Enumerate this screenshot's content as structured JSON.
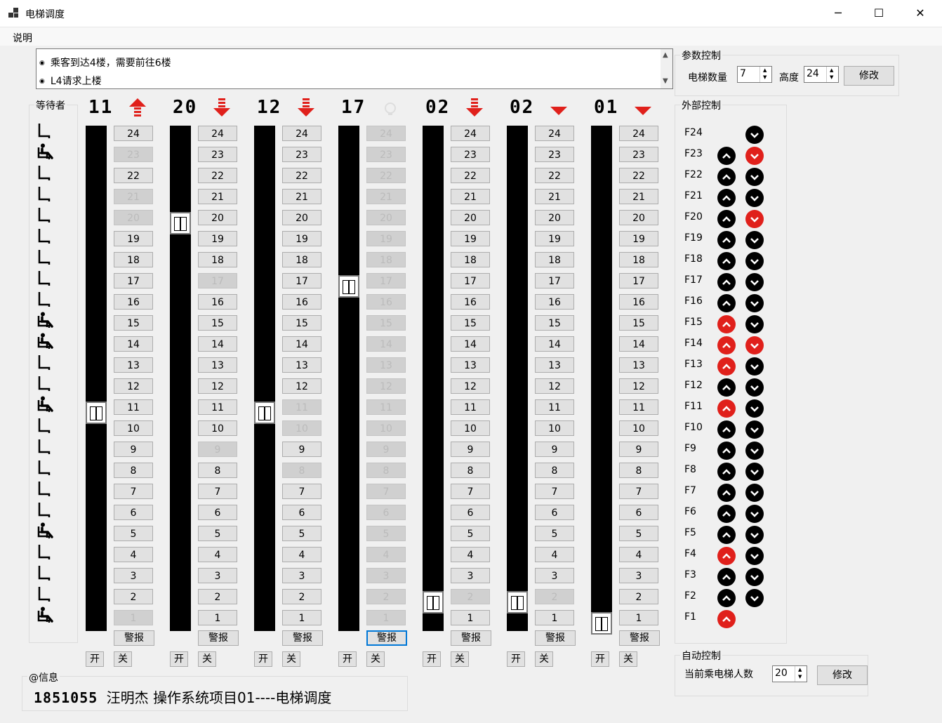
{
  "window": {
    "title": "电梯调度",
    "minimize": "─",
    "maximize": "☐",
    "close": "✕"
  },
  "menu": {
    "help": "说明"
  },
  "messages": [
    "乘客到达4楼，需要前往6楼",
    "L4请求上楼"
  ],
  "waiting": {
    "label": "等待者",
    "seated_floors": [
      23,
      15,
      14,
      11,
      5,
      1
    ]
  },
  "elevators": [
    {
      "floor_display": "11",
      "current_floor": 11,
      "direction": "up",
      "pressed": [
        23,
        21,
        20,
        1
      ],
      "alarm": "警报",
      "open": "开",
      "close": "关"
    },
    {
      "floor_display": "20",
      "current_floor": 20,
      "direction": "down",
      "pressed": [
        17,
        9
      ],
      "alarm": "警报",
      "open": "开",
      "close": "关"
    },
    {
      "floor_display": "12",
      "current_floor": 11,
      "direction": "down",
      "pressed": [
        11,
        10,
        8
      ],
      "alarm": "警报",
      "open": "开",
      "close": "关"
    },
    {
      "floor_display": "17",
      "current_floor": 17,
      "direction": "idle",
      "pressed": [
        24,
        23,
        22,
        21,
        20,
        19,
        18,
        17,
        16,
        15,
        14,
        13,
        12,
        11,
        10,
        9,
        8,
        7,
        6,
        5,
        4,
        3,
        2,
        1
      ],
      "alarm": "警报",
      "open": "开",
      "close": "关"
    },
    {
      "floor_display": "02",
      "current_floor": 2,
      "direction": "down",
      "pressed": [
        2
      ],
      "alarm": "警报",
      "open": "开",
      "close": "关"
    },
    {
      "floor_display": "02",
      "current_floor": 2,
      "direction": "down-solid",
      "pressed": [
        2
      ],
      "alarm": "警报",
      "open": "开",
      "close": "关"
    },
    {
      "floor_display": "01",
      "current_floor": 1,
      "direction": "down-solid",
      "pressed": [],
      "alarm": "警报",
      "open": "开",
      "close": "关"
    }
  ],
  "floors": [
    24,
    23,
    22,
    21,
    20,
    19,
    18,
    17,
    16,
    15,
    14,
    13,
    12,
    11,
    10,
    9,
    8,
    7,
    6,
    5,
    4,
    3,
    2,
    1
  ],
  "params": {
    "label": "参数控制",
    "count_label": "电梯数量",
    "count": "7",
    "height_label": "高度",
    "height": "24",
    "modify": "修改"
  },
  "external": {
    "label": "外部控制",
    "rows": [
      {
        "label": "F24",
        "up": null,
        "down": "off"
      },
      {
        "label": "F23",
        "up": "off",
        "down": "on"
      },
      {
        "label": "F22",
        "up": "off",
        "down": "off"
      },
      {
        "label": "F21",
        "up": "off",
        "down": "off"
      },
      {
        "label": "F20",
        "up": "off",
        "down": "on"
      },
      {
        "label": "F19",
        "up": "off",
        "down": "off"
      },
      {
        "label": "F18",
        "up": "off",
        "down": "off"
      },
      {
        "label": "F17",
        "up": "off",
        "down": "off"
      },
      {
        "label": "F16",
        "up": "off",
        "down": "off"
      },
      {
        "label": "F15",
        "up": "on",
        "down": "off"
      },
      {
        "label": "F14",
        "up": "on",
        "down": "on"
      },
      {
        "label": "F13",
        "up": "on",
        "down": "off"
      },
      {
        "label": "F12",
        "up": "off",
        "down": "off"
      },
      {
        "label": "F11",
        "up": "on",
        "down": "off"
      },
      {
        "label": "F10",
        "up": "off",
        "down": "off"
      },
      {
        "label": "F9",
        "up": "off",
        "down": "off"
      },
      {
        "label": "F8",
        "up": "off",
        "down": "off"
      },
      {
        "label": "F7",
        "up": "off",
        "down": "off"
      },
      {
        "label": "F6",
        "up": "off",
        "down": "off"
      },
      {
        "label": "F5",
        "up": "off",
        "down": "off"
      },
      {
        "label": "F4",
        "up": "on",
        "down": "off"
      },
      {
        "label": "F3",
        "up": "off",
        "down": "off"
      },
      {
        "label": "F2",
        "up": "off",
        "down": "off"
      },
      {
        "label": "F1",
        "up": "on",
        "down": null
      }
    ]
  },
  "auto": {
    "label": "自动控制",
    "people_label": "当前乘电梯人数",
    "people": "20",
    "modify": "修改"
  },
  "info": {
    "label": "@信息",
    "id": "1851055",
    "text": "汪明杰   操作系统项目01----电梯调度"
  },
  "colors": {
    "active": "#e0201b",
    "button": "#e1e1e1",
    "shaft": "#000000"
  }
}
